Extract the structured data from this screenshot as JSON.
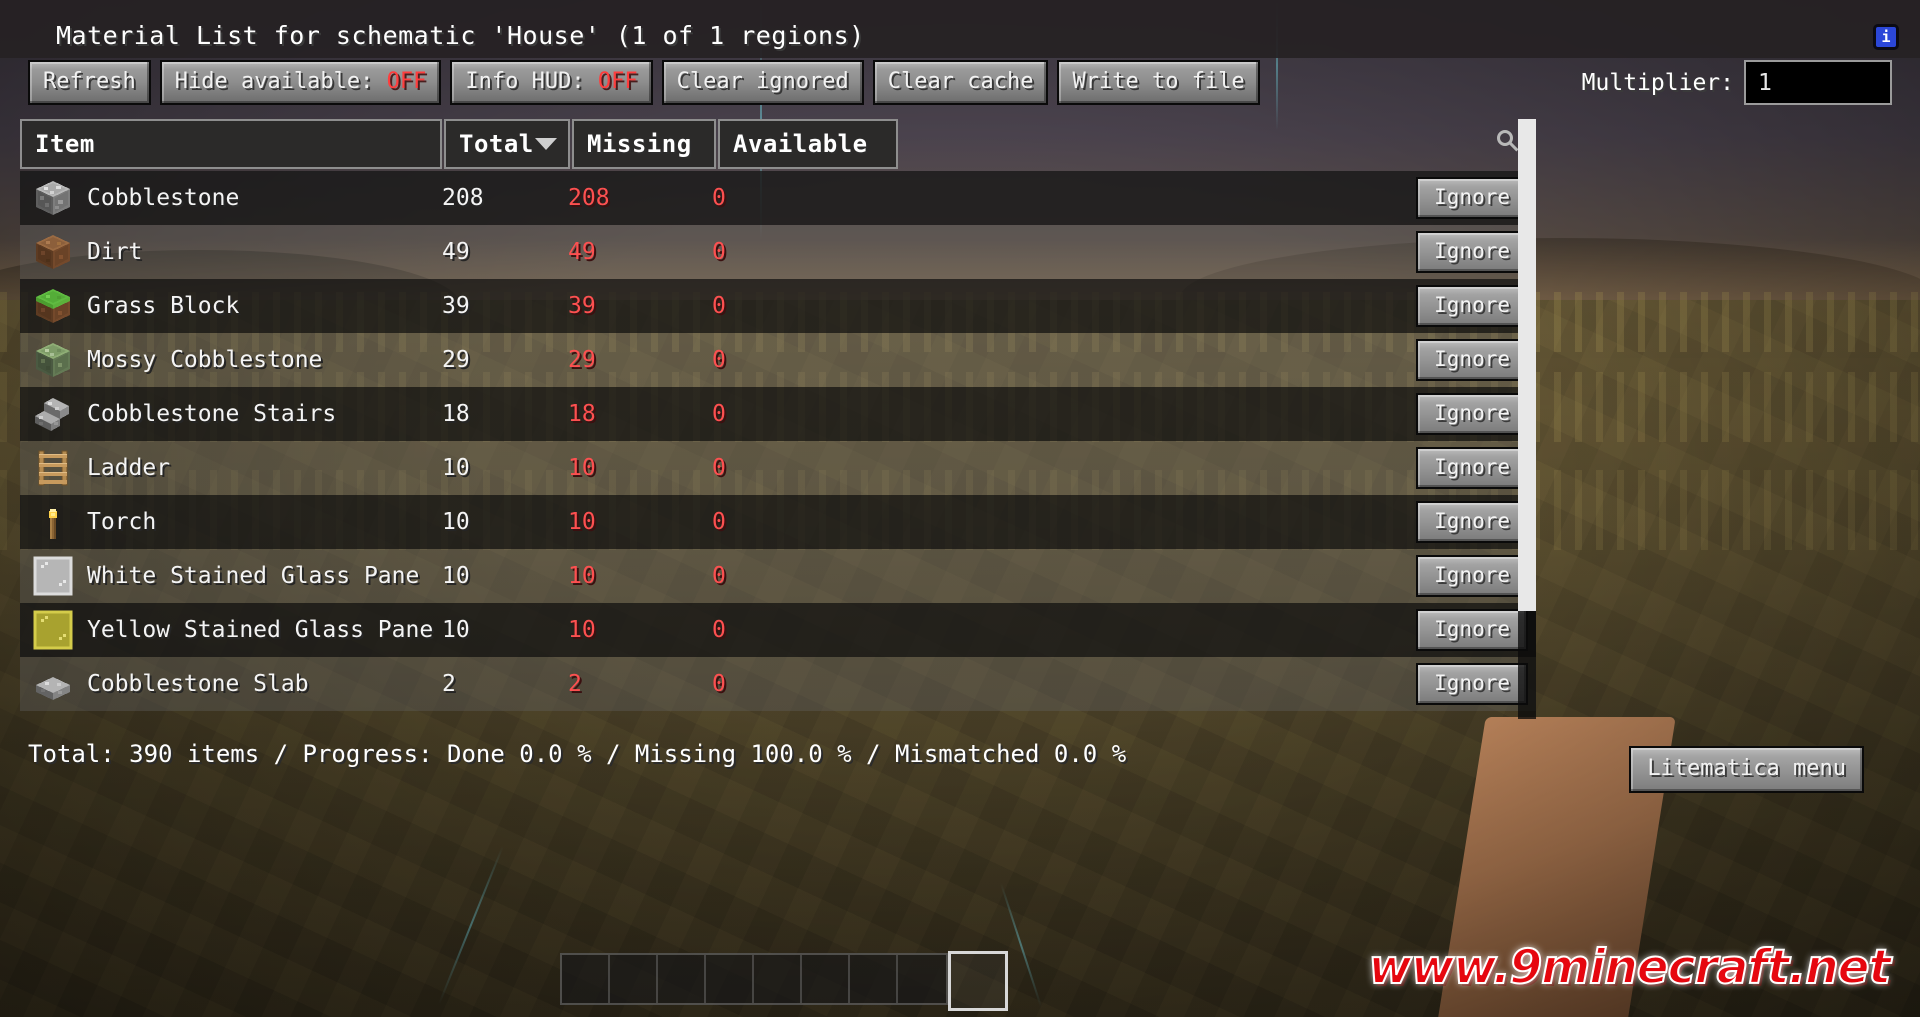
{
  "header": {
    "title": "Material List for schematic 'House' (1 of 1 regions)",
    "info_icon": "info-icon"
  },
  "toolbar": {
    "refresh": "Refresh",
    "hide_available_label": "Hide available: ",
    "hide_available_value": "OFF",
    "info_hud_label": "Info HUD: ",
    "info_hud_value": "OFF",
    "clear_ignored": "Clear ignored",
    "clear_cache": "Clear cache",
    "write_to_file": "Write to file",
    "multiplier_label": "Multiplier:",
    "multiplier_value": "1"
  },
  "table": {
    "columns": {
      "item": "Item",
      "total": "Total",
      "missing": "Missing",
      "available": "Available"
    },
    "sorted_by": "Total",
    "search_icon": "search-icon",
    "ignore_label": "Ignore",
    "rows": [
      {
        "icon": "cobblestone-block-icon",
        "name": "Cobblestone",
        "total": "208",
        "missing": "208",
        "available": "0"
      },
      {
        "icon": "dirt-block-icon",
        "name": "Dirt",
        "total": "49",
        "missing": "49",
        "available": "0"
      },
      {
        "icon": "grass-block-icon",
        "name": "Grass Block",
        "total": "39",
        "missing": "39",
        "available": "0"
      },
      {
        "icon": "mossy-cobblestone-block-icon",
        "name": "Mossy Cobblestone",
        "total": "29",
        "missing": "29",
        "available": "0"
      },
      {
        "icon": "cobblestone-stairs-icon",
        "name": "Cobblestone Stairs",
        "total": "18",
        "missing": "18",
        "available": "0"
      },
      {
        "icon": "ladder-icon",
        "name": "Ladder",
        "total": "10",
        "missing": "10",
        "available": "0"
      },
      {
        "icon": "torch-icon",
        "name": "Torch",
        "total": "10",
        "missing": "10",
        "available": "0"
      },
      {
        "icon": "white-stained-glass-pane-icon",
        "name": "White Stained Glass Pane",
        "total": "10",
        "missing": "10",
        "available": "0"
      },
      {
        "icon": "yellow-stained-glass-pane-icon",
        "name": "Yellow Stained Glass Pane",
        "total": "10",
        "missing": "10",
        "available": "0"
      },
      {
        "icon": "cobblestone-slab-icon",
        "name": "Cobblestone Slab",
        "total": "2",
        "missing": "2",
        "available": "0"
      }
    ]
  },
  "footer": {
    "status": "Total: 390 items / Progress: Done 0.0 % / Missing 100.0 % / Mismatched 0.0 %",
    "litematica_menu": "Litematica menu"
  },
  "watermark": {
    "text": "www.9minecraft.net"
  },
  "colors": {
    "missing_red": "#fd5050",
    "text_white": "#f4f4f4",
    "button_gray": "#9a9a9a",
    "info_blue": "#2b47d8"
  }
}
